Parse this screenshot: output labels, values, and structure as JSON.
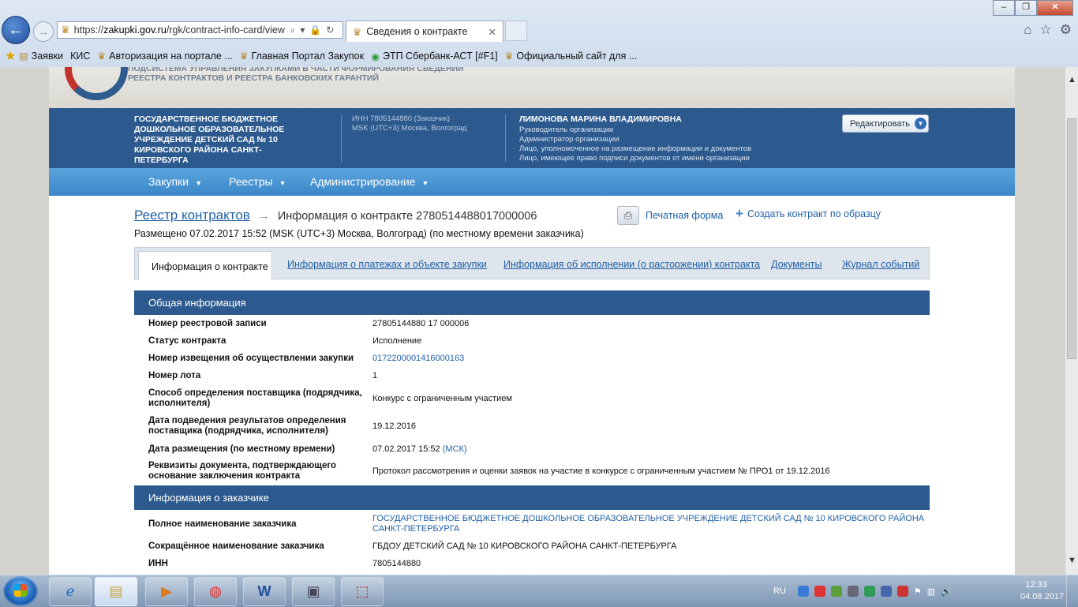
{
  "browser": {
    "url_host": "zakupki.gov.ru",
    "url_prefix": "https://",
    "url_path": "/rgk/contract-info-card/view",
    "active_tab_title": "Сведения о контракте",
    "bookmarks": [
      {
        "label": "Заявки"
      },
      {
        "label": "КИС"
      },
      {
        "label": "Авторизация на портале ..."
      },
      {
        "label": "Главная Портал Закупок"
      },
      {
        "label": "ЭТП Сбербанк-АСТ [#F1]"
      },
      {
        "label": "Официальный сайт для ..."
      }
    ]
  },
  "site": {
    "subtitle_line1": "ПОДСИСТЕМА УПРАВЛЕНИЯ ЗАКУПКАМИ В ЧАСТИ ФОРМИРОВАНИЯ СВЕДЕНИЙ",
    "subtitle_line2": "РЕЕСТРА КОНТРАКТОВ И РЕЕСТРА БАНКОВСКИХ ГАРАНТИЙ"
  },
  "org": {
    "name": "ГОСУДАРСТВЕННОЕ БЮДЖЕТНОЕ ДОШКОЛЬНОЕ ОБРАЗОВАТЕЛЬНОЕ УЧРЕЖДЕНИЕ ДЕТСКИЙ САД № 10 КИРОВСКОГО РАЙОНА САНКТ-ПЕТЕРБУРГА",
    "inn_line": "ИНН 7805144880 (Заказчик)",
    "tz_line": "MSK (UTC+3) Москва, Волгоград",
    "user_name": "ЛИМОНОВА МАРИНА ВЛАДИМИРОВНА",
    "roles": [
      "Руководитель организации",
      "Администратор организации",
      "Лицо, уполномоченное на размещение информации и документов",
      "Лицо, имеющее право подписи документов от имени организации"
    ],
    "edit_label": "Редактировать"
  },
  "menu": {
    "purchases": "Закупки",
    "registries": "Реестры",
    "admin": "Администрирование"
  },
  "breadcrumb": {
    "link": "Реестр контрактов",
    "current": "Информация о контракте 2780514488017000006"
  },
  "placed_line": "Размещено 07.02.2017 15:52 (MSK (UTC+3) Москва, Волгоград) (по местному времени заказчика)",
  "actions": {
    "print_form": "Печатная форма",
    "create_by_sample": "Создать контракт по образцу"
  },
  "tabs": {
    "info": "Информация о контракте",
    "payments": "Информация о платежах и объекте закупки",
    "execution": "Информация об исполнении (о расторжении) контракта",
    "documents": "Документы",
    "events": "Журнал событий"
  },
  "general": {
    "title": "Общая информация",
    "reg_number_label": "Номер реестровой записи",
    "reg_number": "27805144880 17 000006",
    "status_label": "Статус контракта",
    "status": "Исполнение",
    "notice_label": "Номер извещения об осуществлении закупки",
    "notice": "0172200001416000163",
    "lot_label": "Номер лота",
    "lot": "1",
    "method_label": "Способ определения поставщика (подрядчика, исполнителя)",
    "method": "Конкурс с ограниченным участием",
    "results_date_label": "Дата подведения результатов определения поставщика (подрядчика, исполнителя)",
    "results_date": "19.12.2016",
    "placement_date_label": "Дата размещения (по местному времени)",
    "placement_date": "07.02.2017 15:52",
    "placement_tz": "(МСК)",
    "basis_label": "Реквизиты документа, подтверждающего основание заключения контракта",
    "basis": "Протокол рассмотрения и оценки заявок на участие в конкурсе с ограниченным участием № ПРО1 от 19.12.2016"
  },
  "customer": {
    "title": "Информация о заказчике",
    "full_name_label": "Полное наименование заказчика",
    "full_name_line1": "ГОСУДАРСТВЕННОЕ БЮДЖЕТНОЕ ДОШКОЛЬНОЕ ОБРАЗОВАТЕЛЬНОЕ УЧРЕЖДЕНИЕ ДЕТСКИЙ САД № 10 КИРОВСКОГО РАЙОНА",
    "full_name_line2": "САНКТ-ПЕТЕРБУРГА",
    "short_name_label": "Сокращённое наименование заказчика",
    "short_name": "ГБДОУ ДЕТСКИЙ САД № 10 КИРОВСКОГО РАЙОНА САНКТ-ПЕТЕРБУРГА",
    "inn_label": "ИНН",
    "inn": "7805144880"
  },
  "taskbar": {
    "lang": "RU",
    "time": "12:33",
    "date": "04.08.2017"
  }
}
